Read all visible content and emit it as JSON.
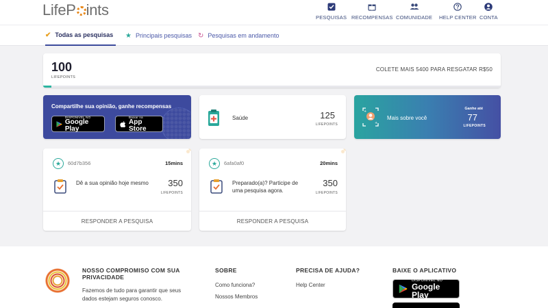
{
  "header": {
    "logo_text_1": "LifeP",
    "logo_text_2": "ints",
    "nav": [
      {
        "label": "PESQUISAS",
        "icon": "checkbox-icon"
      },
      {
        "label": "RECOMPENSAS",
        "icon": "gift-icon"
      },
      {
        "label": "COMUNIDADE",
        "icon": "people-icon"
      },
      {
        "label": "HELP CENTER",
        "icon": "help-icon"
      },
      {
        "label": "CONTA",
        "icon": "account-icon"
      }
    ]
  },
  "tabs": [
    {
      "label": "Todas as pesquisas",
      "icon": "check-icon",
      "active": true
    },
    {
      "label": "Principais pesquisas",
      "icon": "star-icon",
      "active": false
    },
    {
      "label": "Pesquisas em andamento",
      "icon": "refresh-icon",
      "active": false
    }
  ],
  "balance": {
    "points": "100",
    "points_label": "LIFEPOINTS",
    "goal_text": "COLETE MAIS 5400 PARA RESGATAR R$50",
    "progress_percent": 1.8
  },
  "app_card": {
    "title": "Compartilhe sua opinião, ganhe recompensas",
    "google_small": "DISPONÍVEL NO",
    "google_large": "Google Play",
    "apple_small": "Baixar na",
    "apple_large": "App Store"
  },
  "category_card": {
    "label": "Saúde",
    "points": "125",
    "points_label": "LIFEPOINTS"
  },
  "profile_card": {
    "title": "Mais sobre você",
    "earn_label": "Ganhe até",
    "points": "77",
    "points_label": "LIFEPOINTS"
  },
  "surveys": [
    {
      "id": "60d7b356",
      "duration": "15mins",
      "description": "Dê a sua opinião hoje mesmo",
      "points": "350",
      "points_label": "LIFEPOINTS",
      "action": "RESPONDER A PESQUISA"
    },
    {
      "id": "6afa0af0",
      "duration": "20mins",
      "description": "Preparado(a)? Participe de uma pesquisa agora.",
      "points": "350",
      "points_label": "LIFEPOINTS",
      "action": "RESPONDER A PESQUISA"
    }
  ],
  "footer": {
    "privacy_title": "NOSSO COMPROMISO COM SUA PRIVACIDADE",
    "privacy_text": "Fazemos de tudo para garantir que seus dados estejam seguros conosco.",
    "about_title": "SOBRE",
    "about_links": [
      "Como funciona?",
      "Nossos Membros"
    ],
    "help_title": "PRECISA DE AJUDA?",
    "help_link": "Help Center",
    "app_title": "BAIXE O APLICATIVO",
    "gplay_small": "DISPONÍVEL NO",
    "gplay_large": "Google Play"
  },
  "colors": {
    "brand_blue": "#3d4a9e",
    "teal": "#2aa89a",
    "background": "#f2f2f4"
  }
}
